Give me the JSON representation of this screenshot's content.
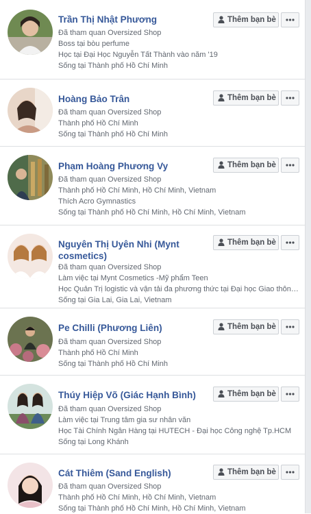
{
  "add_friend_label": "Thêm bạn bè",
  "people": [
    {
      "name": "Trần Thị Nhật Phương",
      "lines": [
        "Đã tham quan Oversized Shop",
        "Boss tại bòu perfume",
        "Học tại Đại Học Nguyễn Tất Thành vào năm '19",
        "Sống tại Thành phố Hồ Chí Minh"
      ]
    },
    {
      "name": "Hoàng Bảo Trân",
      "lines": [
        "Đã tham quan Oversized Shop",
        "Thành phố Hồ Chí Minh",
        "Sống tại Thành phố Hồ Chí Minh"
      ]
    },
    {
      "name": "Phạm Hoàng Phương Vy",
      "lines": [
        "Đã tham quan Oversized Shop",
        "Thành phố Hồ Chí Minh, Hồ Chí Minh, Vietnam",
        "Thích Acro Gymnastics",
        "Sống tại Thành phố Hồ Chí Minh, Hồ Chí Minh, Vietnam"
      ]
    },
    {
      "name": "Nguyên Thị Uyên Nhi (Mynt cosmetics)",
      "lines": [
        "Đã tham quan Oversized Shop",
        "Làm việc tại Mynt Cosmetics -Mỹ phẩm Teen",
        "Học Quản Trị logistic và vận tải đa phương thức tại Đại học Giao thông ...",
        "Sống tại Gia Lai, Gia Lai, Vietnam"
      ]
    },
    {
      "name": "Pe Chilli (Phương Liên)",
      "lines": [
        "Đã tham quan Oversized Shop",
        "Thành phố Hồ Chí Minh",
        "Sống tại Thành phố Hồ Chí Minh"
      ]
    },
    {
      "name": "Thúy Hiệp Võ (Giác Hạnh Bình)",
      "lines": [
        "Đã tham quan Oversized Shop",
        "Làm việc tại Trung tâm gia sư nhân văn",
        "Học Tài Chính Ngân Hàng tại HUTECH - Đại học Công nghệ Tp.HCM",
        "Sống tại Long Khánh"
      ]
    },
    {
      "name": "Cát Thiêm (Sand English)",
      "lines": [
        "Đã tham quan Oversized Shop",
        "Thành phố Hồ Chí Minh, Hồ Chí Minh, Vietnam",
        "Sống tại Thành phố Hồ Chí Minh, Hồ Chí Minh, Vietnam"
      ]
    }
  ]
}
